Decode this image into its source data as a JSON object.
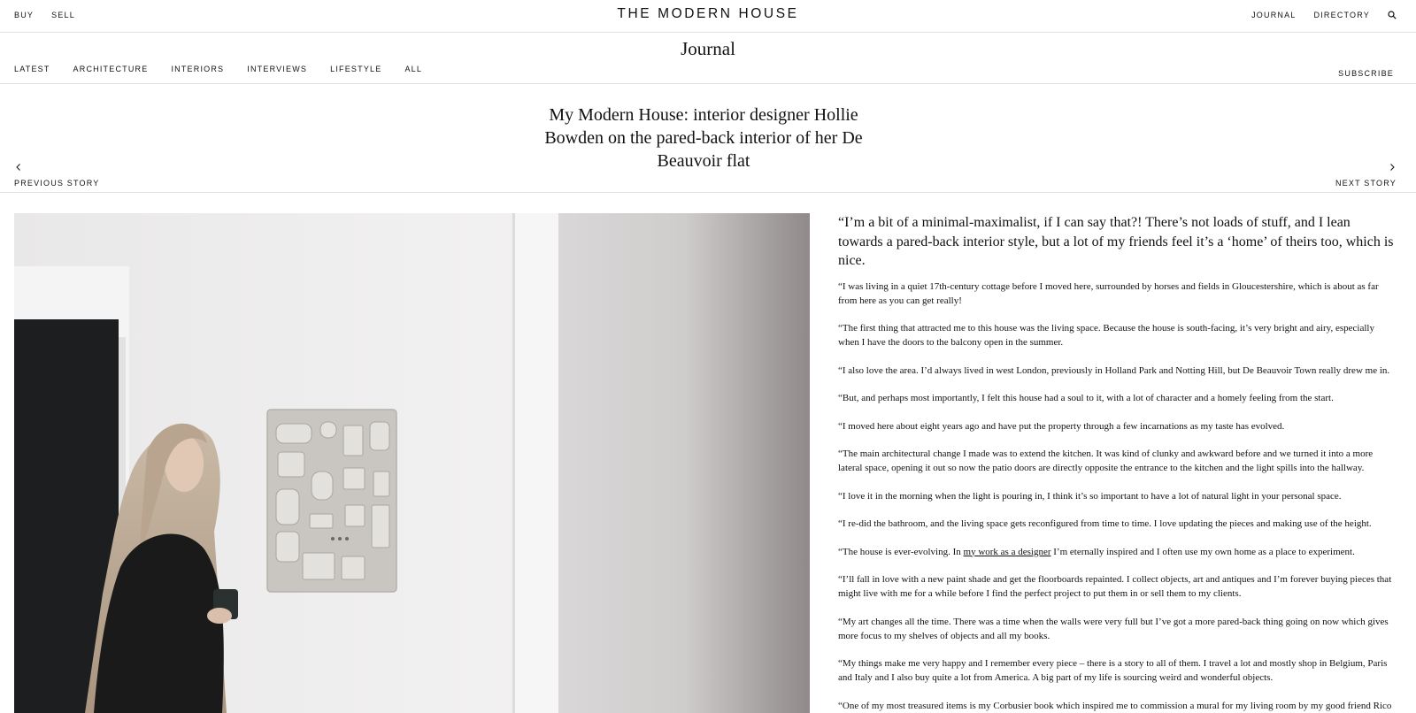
{
  "site": {
    "logo": "THE MODERN HOUSE",
    "top_left_nav": [
      "BUY",
      "SELL"
    ],
    "top_right_nav": [
      "JOURNAL",
      "DIRECTORY"
    ],
    "search_icon": "search-icon"
  },
  "journal": {
    "title": "Journal",
    "nav": [
      "LATEST",
      "ARCHITECTURE",
      "INTERIORS",
      "INTERVIEWS",
      "LIFESTYLE",
      "ALL"
    ],
    "subscribe": "SUBSCRIBE"
  },
  "article": {
    "title": "My Modern House: interior designer Hollie Bowden on the pared-back interior of her De Beauvoir flat",
    "prev_label": "PREVIOUS STORY",
    "next_label": "NEXT STORY",
    "lead": "“I’m a bit of a minimal-maximalist, if I can say that?! There’s not loads of stuff, and I lean towards a pared-back interior style, but a lot of my friends feel it’s a ‘home’ of theirs too, which is nice.",
    "paragraphs": [
      "“I was living in a quiet 17th-century cottage before I moved here, surrounded by horses and fields in Gloucestershire, which is about as far from here as you can get really!",
      "“The first thing that attracted me to this house was the living space. Because the house is south-facing, it’s very bright and airy, especially when I have the doors to the balcony open in the summer.",
      "“I also love the area. I’d always lived in west London, previously in Holland Park and Notting Hill, but De Beauvoir Town really drew me in.",
      "“But, and perhaps most importantly, I felt this house had a soul to it, with a lot of character and a homely feeling from the start.",
      "“I moved here about eight years ago and have put the property through a few incarnations as my taste has evolved.",
      "“The main architectural change I made was to extend the kitchen. It was kind of clunky and awkward before and we turned it into a more lateral space, opening it out so now the patio doors are directly opposite the entrance to the kitchen and the light spills into the hallway.",
      "“I love it in the morning when the light is pouring in, I think it’s so important to have a lot of natural light in your personal space.",
      "“I re-did the bathroom, and the living space gets reconfigured from time to time. I love updating the pieces and making use of the height."
    ],
    "link_para": {
      "before": "“The house is ever-evolving. In ",
      "link": "my work as a designer",
      "after": " I’m eternally inspired and I often use my own home as a place to experiment."
    },
    "paragraphs_after": [
      "“I’ll fall in love with a new paint shade and get the floorboards repainted. I collect objects, art and antiques and I’m forever buying pieces that might live with me for a while before I find the perfect project to put them in or sell them to my clients.",
      "“My art changes all the time. There was a time when the walls were very full but I’ve got a more pared-back thing going on now which gives more focus to my shelves of objects and all my books.",
      "“My things make me very happy and I remember every piece – there is a story to all of them. I travel a lot and mostly shop in Belgium, Paris and Italy and I also buy quite a lot from America. A big part of my life is sourcing weird and wonderful objects.",
      "“One of my most treasured items is my Corbusier book which inspired me to commission a mural for my living room by my good friend Rico White from art school in Gloucestershire."
    ]
  }
}
